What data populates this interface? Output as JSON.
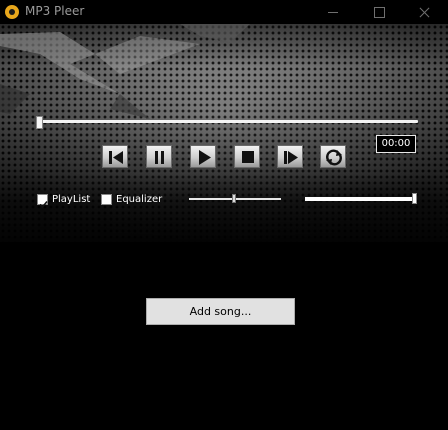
{
  "window": {
    "title": "MP3 Pleer",
    "app_icon": "cd-disc-icon",
    "controls": [
      "minimize-icon",
      "maximize-icon",
      "close-icon"
    ]
  },
  "player": {
    "time": "00:00",
    "seek_position": 0,
    "transport_icons": [
      "skip-back-icon",
      "pause-icon",
      "play-icon",
      "stop-icon",
      "skip-forward-icon",
      "repeat-icon"
    ]
  },
  "options": {
    "playlist": {
      "label": "PlayList",
      "checked": true
    },
    "equalizer": {
      "label": "Equalizer",
      "checked": false
    },
    "balance": 0.47,
    "volume": 1.0
  },
  "playlist_area": {
    "add_song_label": "Add song..."
  },
  "colors": {
    "background": "#000000",
    "skin_metal": "#7a7a7a",
    "accent_icon": "#e8a71c",
    "button_face": "#e1e1e1"
  }
}
